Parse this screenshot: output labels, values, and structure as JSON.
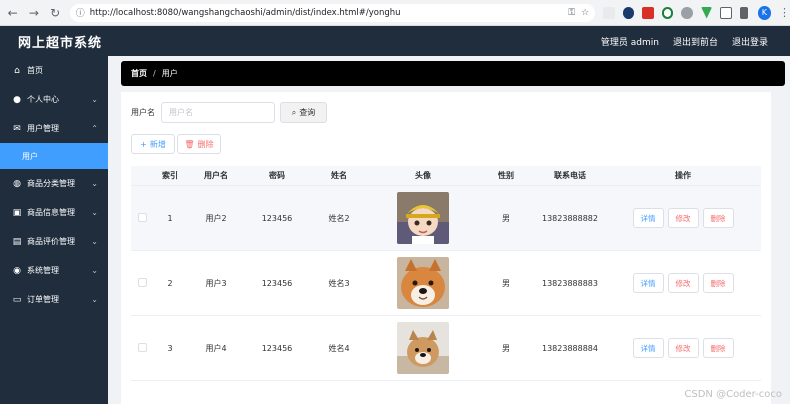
{
  "browser": {
    "url": "http://localhost:8080/wangshangchaoshi/admin/dist/index.html#/yonghu",
    "profile_initial": "K"
  },
  "header": {
    "title": "网上超市系统",
    "user": "管理员 admin",
    "front": "退出到前台",
    "logout": "退出登录"
  },
  "sidebar": {
    "items": [
      {
        "label": "首页",
        "icon": "home-icon"
      },
      {
        "label": "个人中心",
        "icon": "user-icon"
      },
      {
        "label": "用户管理",
        "icon": "mail-icon"
      },
      {
        "label": "用户"
      },
      {
        "label": "商品分类管理",
        "icon": "globe-icon"
      },
      {
        "label": "商品信息管理",
        "icon": "briefcase-icon"
      },
      {
        "label": "商品评价管理",
        "icon": "clipboard-icon"
      },
      {
        "label": "系统管理",
        "icon": "compass-icon"
      },
      {
        "label": "订单管理",
        "icon": "chat-icon"
      }
    ]
  },
  "breadcrumb": {
    "home": "首页",
    "current": "用户"
  },
  "search": {
    "label": "用户名",
    "placeholder": "用户名",
    "button": "查询"
  },
  "actions": {
    "add": "新增",
    "delete": "删除"
  },
  "table": {
    "columns": [
      "索引",
      "用户名",
      "密码",
      "姓名",
      "头像",
      "性别",
      "联系电话",
      "操作"
    ],
    "rows": [
      {
        "index": "1",
        "username": "用户2",
        "password": "123456",
        "name": "姓名2",
        "sex": "男",
        "phone": "13823888882"
      },
      {
        "index": "2",
        "username": "用户3",
        "password": "123456",
        "name": "姓名3",
        "sex": "男",
        "phone": "13823888883"
      },
      {
        "index": "3",
        "username": "用户4",
        "password": "123456",
        "name": "姓名4",
        "sex": "男",
        "phone": "13823888884"
      }
    ],
    "ops": {
      "detail": "详情",
      "edit": "修改",
      "delete": "删除"
    }
  },
  "watermark": "CSDN @Coder-coco",
  "colors": {
    "sidebar_bg": "#1f2d3d",
    "active_menu": "#409eff",
    "breadcrumb_bg": "#000000",
    "danger": "#f56c6c"
  }
}
